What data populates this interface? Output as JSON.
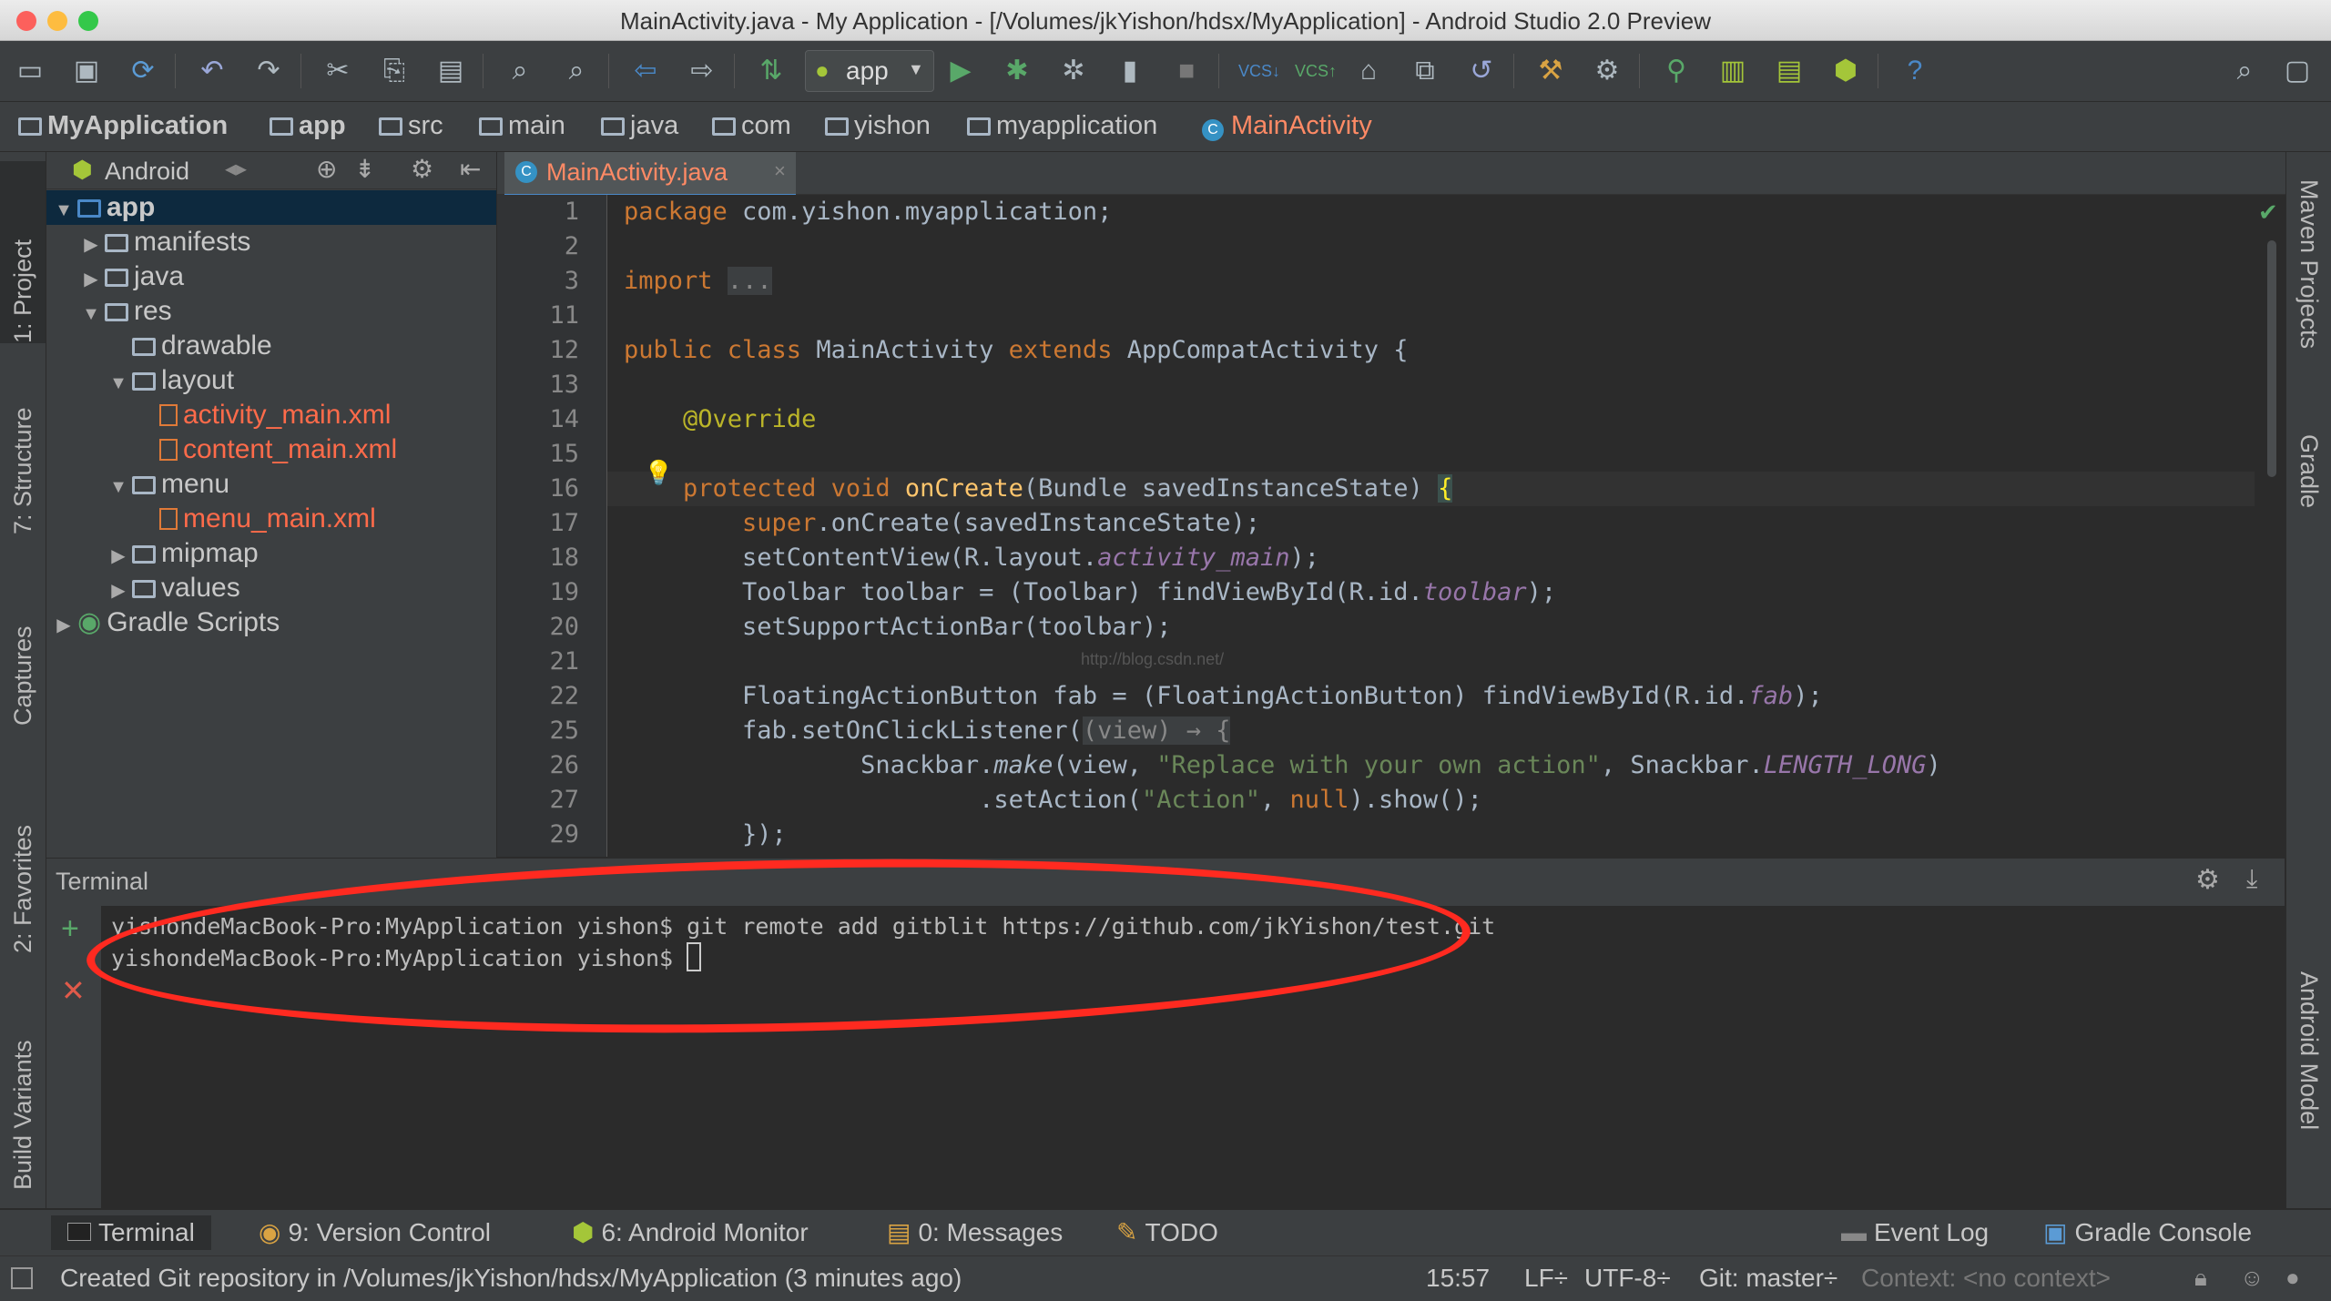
{
  "window": {
    "title": "MainActivity.java - My Application - [/Volumes/jkYishon/hdsx/MyApplication] - Android Studio 2.0 Preview"
  },
  "toolbar": {
    "run_config": "app",
    "icons": [
      "folder-open-icon",
      "save-icon",
      "sync-icon",
      "undo-icon",
      "redo-icon",
      "cut-icon",
      "copy-icon",
      "paste-icon",
      "find-icon",
      "replace-icon",
      "back-icon",
      "forward-icon",
      "make-icon",
      "run-config",
      "run-icon",
      "debug-icon",
      "attach-icon",
      "coverage-icon",
      "stop-icon",
      "vcs-update-icon",
      "vcs-commit-icon",
      "vcs-history-icon",
      "vcs-compare-icon",
      "vcs-revert-icon",
      "project-structure-icon",
      "settings-icon",
      "avd-icon",
      "sdk-icon",
      "device-monitor-icon",
      "android-icon",
      "help-icon",
      "search-icon",
      "user-icon"
    ]
  },
  "breadcrumb": [
    "MyApplication",
    "app",
    "src",
    "main",
    "java",
    "com",
    "yishon",
    "myapplication",
    "MainActivity"
  ],
  "left_tabs": [
    "1: Project",
    "7: Structure",
    "Captures",
    "2: Favorites",
    "Build Variants"
  ],
  "right_tabs": [
    "Maven Projects",
    "Gradle",
    "Android Model"
  ],
  "project": {
    "view_mode": "Android",
    "tree": [
      {
        "label": "app",
        "level": 0,
        "arrow": "▼",
        "sel": true
      },
      {
        "label": "manifests",
        "level": 1,
        "arrow": "▶"
      },
      {
        "label": "java",
        "level": 1,
        "arrow": "▶"
      },
      {
        "label": "res",
        "level": 1,
        "arrow": "▼"
      },
      {
        "label": "drawable",
        "level": 2,
        "arrow": ""
      },
      {
        "label": "layout",
        "level": 2,
        "arrow": "▼"
      },
      {
        "label": "activity_main.xml",
        "level": 3,
        "arrow": "",
        "red": true
      },
      {
        "label": "content_main.xml",
        "level": 3,
        "arrow": "",
        "red": true
      },
      {
        "label": "menu",
        "level": 2,
        "arrow": "▼"
      },
      {
        "label": "menu_main.xml",
        "level": 3,
        "arrow": "",
        "red": true
      },
      {
        "label": "mipmap",
        "level": 2,
        "arrow": "▶"
      },
      {
        "label": "values",
        "level": 2,
        "arrow": "▶"
      },
      {
        "label": "Gradle Scripts",
        "level": 0,
        "arrow": "▶",
        "gradle": true
      }
    ]
  },
  "editor": {
    "tab_label": "MainActivity.java",
    "line_numbers": [
      "1",
      "2",
      "3",
      "11",
      "12",
      "13",
      "14",
      "15",
      "16",
      "17",
      "18",
      "19",
      "20",
      "21",
      "22",
      "25",
      "26",
      "27",
      "29"
    ],
    "watermark": "http://blog.csdn.net/"
  },
  "terminal": {
    "title": "Terminal",
    "lines": [
      "yishondeMacBook-Pro:MyApplication yishon$ git remote add gitblit https://github.com/jkYishon/test.git",
      "yishondeMacBook-Pro:MyApplication yishon$ "
    ]
  },
  "bottom_tabs": {
    "terminal": "Terminal",
    "version_control": "9: Version Control",
    "android_monitor": "6: Android Monitor",
    "messages": "0: Messages",
    "todo": "TODO",
    "event_log": "Event Log",
    "gradle_console": "Gradle Console"
  },
  "status": {
    "message": "Created Git repository in /Volumes/jkYishon/hdsx/MyApplication (3 minutes ago)",
    "position": "15:57",
    "line_sep": "LF÷",
    "encoding": "UTF-8÷",
    "git": "Git: master÷",
    "context": "Context: <no context>"
  },
  "colors": {
    "accent_red": "#ff2a20",
    "keyword": "#cc7832",
    "string": "#6a8759",
    "annotation": "#bbb529",
    "selection": "#0d293e"
  }
}
